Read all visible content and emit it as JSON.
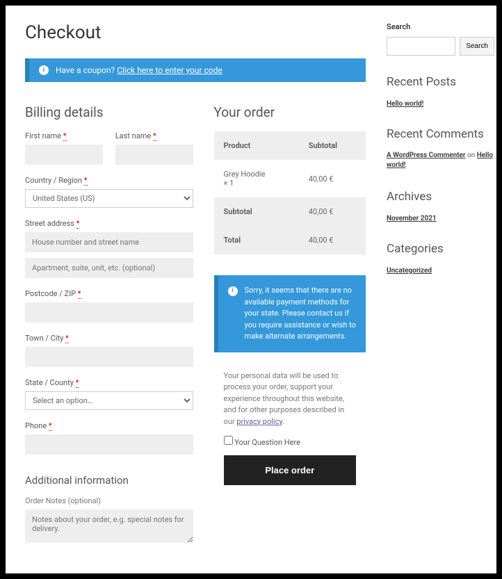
{
  "page_title": "Checkout",
  "coupon": {
    "prompt": "Have a coupon?",
    "link": "Click here to enter your code"
  },
  "billing": {
    "heading": "Billing details",
    "first_name": "First name",
    "last_name": "Last name",
    "country": "Country / Region",
    "country_value": "United States (US)",
    "street": "Street address",
    "street_ph": "House number and street name",
    "street2_ph": "Apartment, suite, unit, etc. (optional)",
    "postcode": "Postcode / ZIP",
    "town": "Town / City",
    "state": "State / County",
    "state_value": "Select an option…",
    "phone": "Phone"
  },
  "additional": {
    "heading": "Additional information",
    "notes_label": "Order Notes (optional)",
    "notes_ph": "Notes about your order, e.g. special notes for delivery."
  },
  "order": {
    "heading": "Your order",
    "col_product": "Product",
    "col_subtotal": "Subtotal",
    "item_name": "Grey Hoodie",
    "item_qty": "× 1",
    "item_price": "40,00 €",
    "subtotal_label": "Subtotal",
    "subtotal_value": "40,00 €",
    "total_label": "Total",
    "total_value": "40,00 €",
    "payment_msg": "Sorry, it seems that there are no available payment methods for your state. Please contact us if you require assistance or wish to make alternate arrangements.",
    "privacy_text": "Your personal data will be used to process your order, support your experience throughout this website, and for other purposes described in our ",
    "privacy_link": "privacy policy",
    "checkbox_label": "Your Question Here",
    "place_order": "Place order"
  },
  "sidebar": {
    "search_label": "Search",
    "search_btn": "Search",
    "recent_posts": "Recent Posts",
    "post1": "Hello world!",
    "recent_comments": "Recent Comments",
    "commenter": "A WordPress Commenter",
    "on": " on ",
    "comment_post": "Hello world!",
    "archives": "Archives",
    "archive1": "November 2021",
    "categories": "Categories",
    "cat1": "Uncategorized"
  },
  "required_mark": "*"
}
